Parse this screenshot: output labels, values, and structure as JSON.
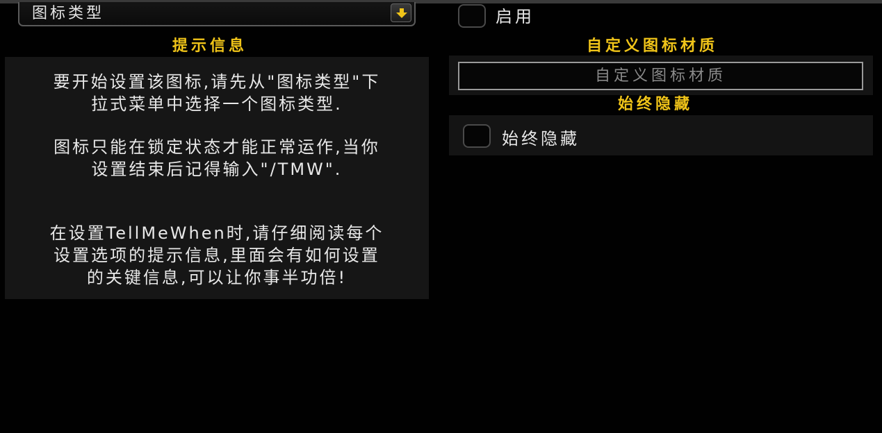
{
  "left": {
    "dropdown_label": "图标类型",
    "tooltip_title": "提示信息",
    "tooltip_lines": [
      "要开始设置该图标,请先从\"图标类型\"下",
      "拉式菜单中选择一个图标类型.",
      "图标只能在锁定状态才能正常运作,当你",
      "设置结束后记得输入\"/TMW\".",
      "在设置TellMeWhen时,请仔细阅读每个",
      "设置选项的提示信息,里面会有如何设置",
      "的关键信息,可以让你事半功倍!"
    ]
  },
  "right": {
    "enable_label": "启用",
    "texture_title": "自定义图标材质",
    "texture_placeholder": "自定义图标材质",
    "hide_title": "始终隐藏",
    "hide_label": "始终隐藏"
  },
  "colors": {
    "title_gold": "#f0c419",
    "text": "#e8e8e8",
    "background": "#010101"
  }
}
